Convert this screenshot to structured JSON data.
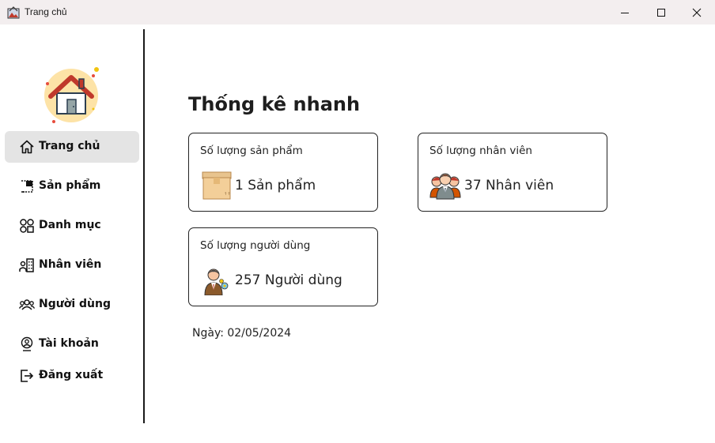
{
  "window": {
    "title": "Trang chủ"
  },
  "sidebar": {
    "items": [
      {
        "label": "Trang chủ",
        "icon": "home-icon",
        "active": true
      },
      {
        "label": "Sản phẩm",
        "icon": "product-icon",
        "active": false
      },
      {
        "label": "Danh mục",
        "icon": "category-icon",
        "active": false
      },
      {
        "label": "Nhân viên",
        "icon": "employee-icon",
        "active": false
      },
      {
        "label": "Người dùng",
        "icon": "users-icon",
        "active": false
      },
      {
        "label": "Tài khoản",
        "icon": "account-icon",
        "active": false
      },
      {
        "label": "Đăng xuất",
        "icon": "logout-icon",
        "active": false
      }
    ]
  },
  "main": {
    "heading": "Thống kê nhanh",
    "cards": [
      {
        "label": "Số lượng sản phẩm",
        "value": "1 Sản phẩm",
        "icon": "box-icon"
      },
      {
        "label": "Số lượng nhân viên",
        "value": "37 Nhân viên",
        "icon": "staff-group-icon"
      },
      {
        "label": "Số lượng người dùng",
        "value": "257 Người dùng",
        "icon": "user-person-icon"
      }
    ],
    "date_text": "Ngày: 02/05/2024"
  },
  "colors": {
    "active_nav_bg": "#e4e4e4",
    "titlebar_bg": "#f3eeef"
  }
}
